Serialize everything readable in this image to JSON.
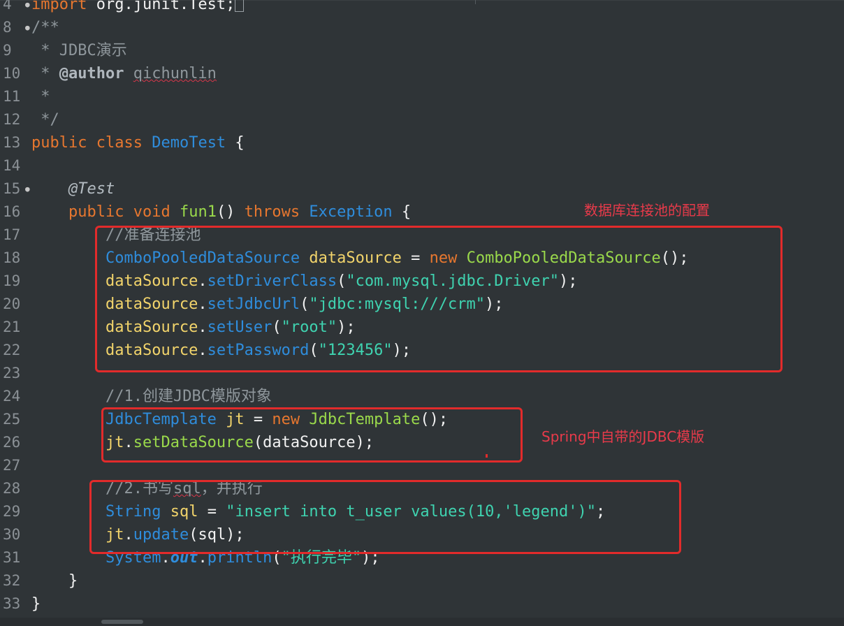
{
  "editor": {
    "lines": [
      {
        "num": "4",
        "fold": true,
        "tokens": [
          [
            "kw",
            "import"
          ],
          [
            "plain",
            " org.junit.Test;"
          ]
        ],
        "cursor": true
      },
      {
        "num": "8",
        "fold": true,
        "tokens": [
          [
            "cmt",
            "/**"
          ]
        ]
      },
      {
        "num": "9",
        "tokens": [
          [
            "cmt",
            " * JDBC演示"
          ]
        ]
      },
      {
        "num": "10",
        "tokens": [
          [
            "cmt",
            " * "
          ],
          [
            "doctag",
            "@author"
          ],
          [
            "cmt",
            " "
          ],
          [
            "cmt-err",
            "qichunlin"
          ]
        ]
      },
      {
        "num": "11",
        "tokens": [
          [
            "cmt",
            " *"
          ]
        ]
      },
      {
        "num": "12",
        "tokens": [
          [
            "cmt",
            " */"
          ]
        ]
      },
      {
        "num": "13",
        "tokens": [
          [
            "kw",
            "public"
          ],
          [
            "plain",
            " "
          ],
          [
            "kw",
            "class"
          ],
          [
            "plain",
            " "
          ],
          [
            "type",
            "DemoTest"
          ],
          [
            "plain",
            " {"
          ]
        ]
      },
      {
        "num": "14",
        "tokens": []
      },
      {
        "num": "15",
        "fold": true,
        "tokens": [
          [
            "plain",
            "    "
          ],
          [
            "ann",
            "@Test"
          ]
        ]
      },
      {
        "num": "16",
        "tokens": [
          [
            "plain",
            "    "
          ],
          [
            "kw",
            "public"
          ],
          [
            "plain",
            " "
          ],
          [
            "kw",
            "void"
          ],
          [
            "plain",
            " "
          ],
          [
            "method",
            "fun1"
          ],
          [
            "plain",
            "() "
          ],
          [
            "kw",
            "throws"
          ],
          [
            "plain",
            " "
          ],
          [
            "type",
            "Exception"
          ],
          [
            "plain",
            " {"
          ]
        ]
      },
      {
        "num": "17",
        "tokens": [
          [
            "plain",
            "        "
          ],
          [
            "cmt",
            "//准备连接池"
          ]
        ]
      },
      {
        "num": "18",
        "tokens": [
          [
            "plain",
            "        "
          ],
          [
            "type",
            "ComboPooledDataSource"
          ],
          [
            "plain",
            " "
          ],
          [
            "var",
            "dataSource"
          ],
          [
            "plain",
            " = "
          ],
          [
            "kw",
            "new"
          ],
          [
            "plain",
            " "
          ],
          [
            "method",
            "ComboPooledDataSource"
          ],
          [
            "plain",
            "();"
          ]
        ]
      },
      {
        "num": "19",
        "tokens": [
          [
            "plain",
            "        "
          ],
          [
            "var",
            "dataSource"
          ],
          [
            "plain",
            "."
          ],
          [
            "type",
            "setDriverClass"
          ],
          [
            "plain",
            "("
          ],
          [
            "str",
            "\"com.mysql.jdbc.Driver\""
          ],
          [
            "plain",
            ");"
          ]
        ]
      },
      {
        "num": "20",
        "tokens": [
          [
            "plain",
            "        "
          ],
          [
            "var",
            "dataSource"
          ],
          [
            "plain",
            "."
          ],
          [
            "type",
            "setJdbcUrl"
          ],
          [
            "plain",
            "("
          ],
          [
            "str",
            "\"jdbc:mysql:///crm\""
          ],
          [
            "plain",
            ");"
          ]
        ]
      },
      {
        "num": "21",
        "tokens": [
          [
            "plain",
            "        "
          ],
          [
            "var",
            "dataSource"
          ],
          [
            "plain",
            "."
          ],
          [
            "type",
            "setUser"
          ],
          [
            "plain",
            "("
          ],
          [
            "str",
            "\"root\""
          ],
          [
            "plain",
            ");"
          ]
        ]
      },
      {
        "num": "22",
        "tokens": [
          [
            "plain",
            "        "
          ],
          [
            "var",
            "dataSource"
          ],
          [
            "plain",
            "."
          ],
          [
            "type",
            "setPassword"
          ],
          [
            "plain",
            "("
          ],
          [
            "str",
            "\"123456\""
          ],
          [
            "plain",
            ");"
          ]
        ]
      },
      {
        "num": "23",
        "tokens": []
      },
      {
        "num": "24",
        "tokens": [
          [
            "plain",
            "        "
          ],
          [
            "cmt",
            "//1.创建JDBC模版对象"
          ]
        ]
      },
      {
        "num": "25",
        "tokens": [
          [
            "plain",
            "        "
          ],
          [
            "type",
            "JdbcTemplate"
          ],
          [
            "plain",
            " "
          ],
          [
            "var",
            "jt"
          ],
          [
            "plain",
            " = "
          ],
          [
            "kw",
            "new"
          ],
          [
            "plain",
            " "
          ],
          [
            "method",
            "JdbcTemplate"
          ],
          [
            "plain",
            "();"
          ]
        ]
      },
      {
        "num": "26",
        "tokens": [
          [
            "plain",
            "        "
          ],
          [
            "var",
            "jt"
          ],
          [
            "plain",
            "."
          ],
          [
            "method",
            "setDataSource"
          ],
          [
            "plain",
            "(dataSource);"
          ]
        ]
      },
      {
        "num": "27",
        "tokens": []
      },
      {
        "num": "28",
        "tokens": [
          [
            "plain",
            "        "
          ],
          [
            "cmt",
            "//2.书写"
          ],
          [
            "cmt-err",
            "sql"
          ],
          [
            "cmt",
            "，并执行"
          ]
        ]
      },
      {
        "num": "29",
        "tokens": [
          [
            "plain",
            "        "
          ],
          [
            "type",
            "String"
          ],
          [
            "plain",
            " "
          ],
          [
            "var",
            "sql"
          ],
          [
            "plain",
            " = "
          ],
          [
            "str",
            "\"insert into t_user values(10,'legend')\""
          ],
          [
            "plain",
            ";"
          ]
        ]
      },
      {
        "num": "30",
        "tokens": [
          [
            "plain",
            "        "
          ],
          [
            "var",
            "jt"
          ],
          [
            "plain",
            "."
          ],
          [
            "type",
            "update"
          ],
          [
            "plain",
            "(sql);"
          ]
        ]
      },
      {
        "num": "31",
        "tokens": [
          [
            "plain",
            "        "
          ],
          [
            "type",
            "System"
          ],
          [
            "plain",
            "."
          ],
          [
            "field",
            "out"
          ],
          [
            "plain",
            "."
          ],
          [
            "type",
            "println"
          ],
          [
            "plain",
            "("
          ],
          [
            "str",
            "\"执行完毕\""
          ],
          [
            "plain",
            ");"
          ]
        ]
      },
      {
        "num": "32",
        "tokens": [
          [
            "plain",
            "    }"
          ]
        ]
      },
      {
        "num": "33",
        "tokens": [
          [
            "plain",
            "}"
          ]
        ]
      }
    ]
  },
  "annotations": {
    "pool_config": "数据库连接池的配置",
    "spring_template": "Spring中自带的JDBC模版"
  }
}
